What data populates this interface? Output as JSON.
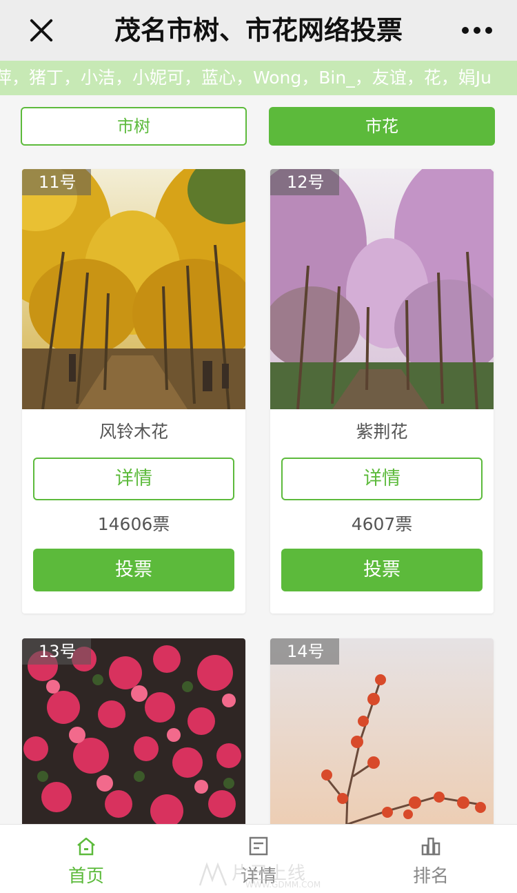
{
  "header": {
    "title": "茂名市树、市花网络投票",
    "close_icon": "close-icon",
    "more_icon": "more-dots-icon"
  },
  "marquee": {
    "text": "萍，猪丁，小洁，小妮可，蓝心，Wong，Bin_，友谊，花，娟Ju"
  },
  "segments": {
    "tree_label": "市树",
    "flower_label": "市花",
    "active": "市花"
  },
  "cards": [
    {
      "badge": "11号",
      "name": "风铃木花",
      "detail_label": "详情",
      "votes": "14606票",
      "vote_label": "投票"
    },
    {
      "badge": "12号",
      "name": "紫荆花",
      "detail_label": "详情",
      "votes": "4607票",
      "vote_label": "投票"
    },
    {
      "badge": "13号"
    },
    {
      "badge": "14号"
    }
  ],
  "tabbar": {
    "items": [
      {
        "label": "首页",
        "icon": "home-icon",
        "active": true
      },
      {
        "label": "详情",
        "icon": "document-icon",
        "active": false
      },
      {
        "label": "排名",
        "icon": "ranking-icon",
        "active": false
      }
    ]
  },
  "watermark": {
    "main": "片已上线",
    "sub": "WWW.GDMM.COM"
  },
  "colors": {
    "accent": "#5cba3b",
    "marquee_bg": "#c7e9b5",
    "topbar_bg": "#ededed"
  }
}
